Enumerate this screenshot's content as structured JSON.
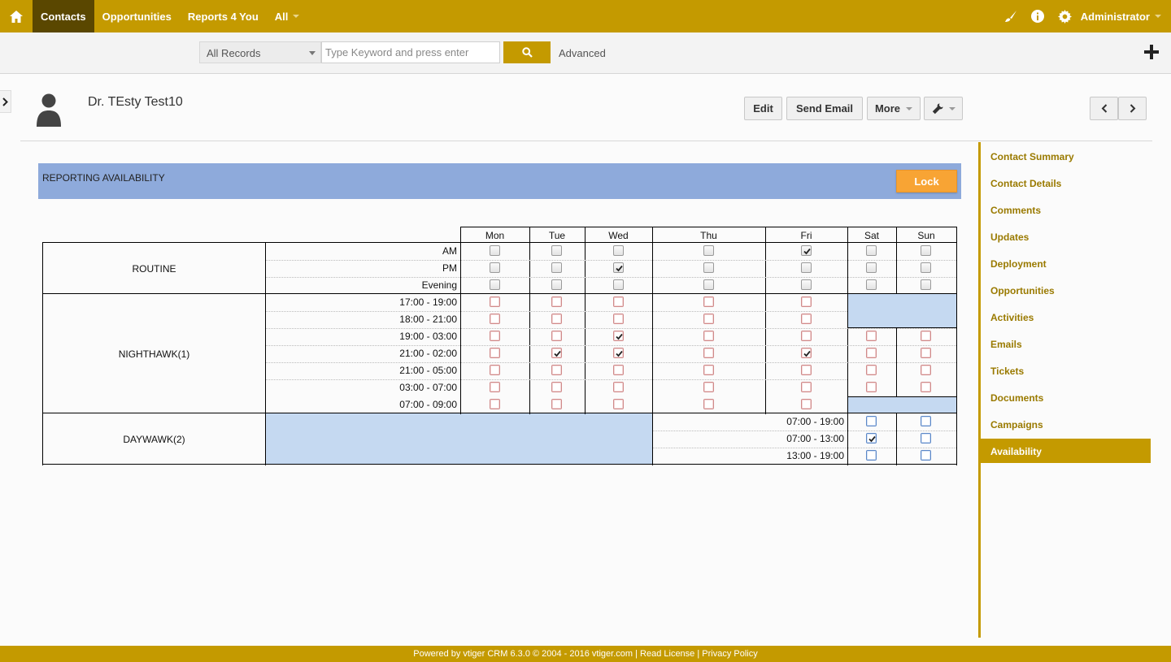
{
  "nav": {
    "items": [
      "Contacts",
      "Opportunities",
      "Reports 4 You",
      "All"
    ],
    "user": "Administrator"
  },
  "search": {
    "filter": "All Records",
    "placeholder": "Type Keyword and press enter",
    "advanced": "Advanced"
  },
  "record": {
    "name": "Dr. TEsty Test10",
    "buttons": {
      "edit": "Edit",
      "send_email": "Send Email",
      "more": "More"
    }
  },
  "sidebar": {
    "items": [
      "Contact Summary",
      "Contact Details",
      "Comments",
      "Updates",
      "Deployment",
      "Opportunities",
      "Activities",
      "Emails",
      "Tickets",
      "Documents",
      "Campaigns",
      "Availability"
    ],
    "active": "Availability"
  },
  "availability": {
    "title": "REPORTING AVAILABILITY",
    "lock_label": "Lock",
    "days": [
      "Mon",
      "Tue",
      "Wed",
      "Thu",
      "Fri",
      "Sat",
      "Sun"
    ],
    "groups": [
      {
        "name": "ROUTINE",
        "rows": [
          {
            "label": "AM",
            "checked": [
              false,
              false,
              false,
              false,
              true,
              false,
              false
            ]
          },
          {
            "label": "PM",
            "checked": [
              false,
              false,
              true,
              false,
              false,
              false,
              false
            ]
          },
          {
            "label": "Evening",
            "checked": [
              false,
              false,
              false,
              false,
              false,
              false,
              false
            ]
          }
        ]
      },
      {
        "name": "NIGHTHAWK(1)",
        "rows": [
          {
            "label": "17:00 - 19:00",
            "checked": [
              false,
              false,
              false,
              false,
              false
            ]
          },
          {
            "label": "18:00 - 21:00",
            "checked": [
              false,
              false,
              false,
              false,
              false
            ]
          },
          {
            "label": "19:00 - 03:00",
            "checked": [
              false,
              false,
              true,
              false,
              false,
              false,
              false
            ]
          },
          {
            "label": "21:00 - 02:00",
            "checked": [
              false,
              true,
              true,
              false,
              true,
              false,
              false
            ]
          },
          {
            "label": "21:00 - 05:00",
            "checked": [
              false,
              false,
              false,
              false,
              false,
              false,
              false
            ]
          },
          {
            "label": "03:00 - 07:00",
            "checked": [
              false,
              false,
              false,
              false,
              false,
              false,
              false
            ]
          },
          {
            "label": "07:00 - 09:00",
            "checked": [
              false,
              false,
              false,
              false,
              false
            ]
          }
        ]
      },
      {
        "name": "DAYWAWK(2)",
        "rows": [
          {
            "label": "07:00 - 19:00",
            "checked": [
              false,
              false
            ]
          },
          {
            "label": "07:00 - 13:00",
            "checked": [
              true,
              false
            ]
          },
          {
            "label": "13:00 - 19:00",
            "checked": [
              false,
              false
            ]
          }
        ]
      }
    ]
  },
  "footer": "Powered by vtiger CRM 6.3.0  © 2004 - 2016  vtiger.com | Read License | Privacy Policy",
  "colors": {
    "brand": "#c49a00",
    "band": "#8eaadb",
    "cell_fill": "#c5d9f1",
    "lock": "#f8a434"
  }
}
